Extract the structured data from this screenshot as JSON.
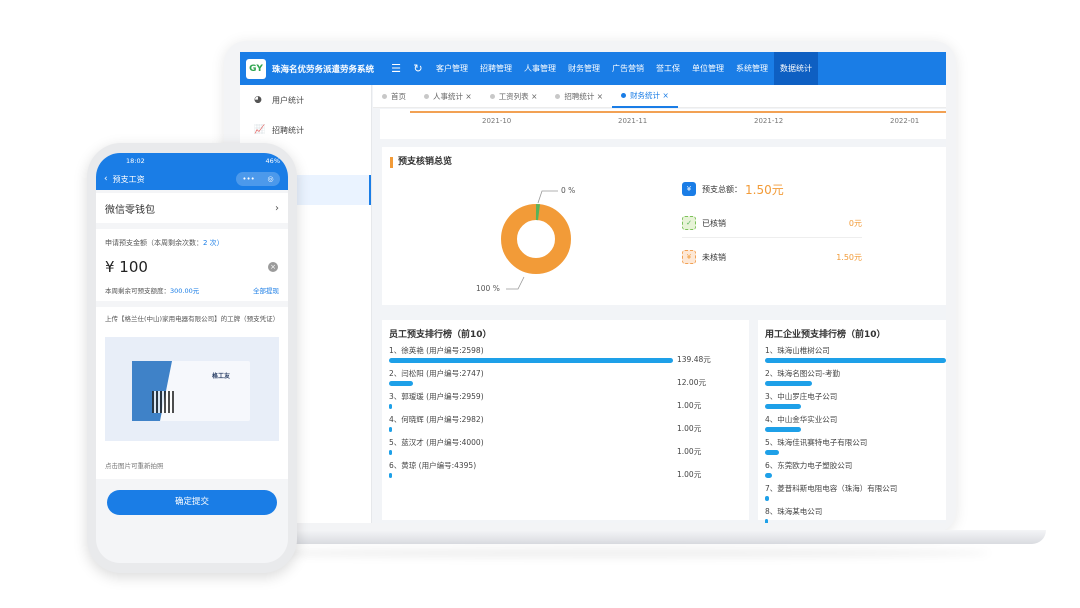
{
  "desktop": {
    "system_title": "珠海名优劳务派遣劳务系统",
    "nav_items": [
      "客户管理",
      "招聘管理",
      "人事管理",
      "财务管理",
      "广告营销",
      "誉工保",
      "单位管理",
      "系统管理",
      "数据统计"
    ],
    "active_nav": "数据统计",
    "sidebar_items": [
      {
        "label": "用户统计",
        "icon": "pie-chart-icon"
      },
      {
        "label": "招聘统计",
        "icon": "line-chart-icon"
      },
      {
        "label": "",
        "icon": "plus-icon"
      },
      {
        "label": "",
        "icon": ""
      }
    ],
    "tabs": [
      {
        "label": "首页",
        "close": ""
      },
      {
        "label": "人事统计",
        "close": "×"
      },
      {
        "label": "工资列表",
        "close": "×"
      },
      {
        "label": "招聘统计",
        "close": "×"
      },
      {
        "label": "财务统计",
        "close": "×"
      }
    ],
    "timeline_ticks": [
      "2021-10",
      "2021-11",
      "2021-12",
      "2022-01"
    ],
    "overview": {
      "title": "预支核销总览",
      "total_label": "预支总额：",
      "total_value": "1.50元",
      "verified_label": "已核销",
      "verified_value": "0元",
      "unverified_label": "未核销",
      "unverified_value": "1.50元",
      "pie_label_top": "0 %",
      "pie_label_bottom": "100 %"
    },
    "employee_rank": {
      "title": "员工预支排行榜（前10）",
      "rows": [
        {
          "name": "1、徐英艳 (用户编号:2598)",
          "value": "139.48元",
          "amount": 139.48
        },
        {
          "name": "2、闫松阳 (用户编号:2747)",
          "value": "12.00元",
          "amount": 12.0
        },
        {
          "name": "3、郭瑷瑗 (用户编号:2959)",
          "value": "1.00元",
          "amount": 1.0
        },
        {
          "name": "4、何晓辉 (用户编号:2982)",
          "value": "1.00元",
          "amount": 1.0
        },
        {
          "name": "5、蓝汉才 (用户编号:4000)",
          "value": "1.00元",
          "amount": 1.0
        },
        {
          "name": "6、黄琼 (用户编号:4395)",
          "value": "1.00元",
          "amount": 1.0
        }
      ]
    },
    "company_rank": {
      "title": "用工企业预支排行榜（前10）",
      "rows": [
        {
          "name": "1、珠海山椎树公司",
          "share": 1.0
        },
        {
          "name": "2、珠海名图公司-考勤",
          "share": 0.26
        },
        {
          "name": "3、中山罗庄电子公司",
          "share": 0.2
        },
        {
          "name": "4、中山金华实业公司",
          "share": 0.2
        },
        {
          "name": "5、珠海佳讯赛特电子有限公司",
          "share": 0.08
        },
        {
          "name": "6、东莞欧力电子塑胶公司",
          "share": 0.04
        },
        {
          "name": "7、菱普科斯电阻电容（珠海）有限公司",
          "share": 0.02
        },
        {
          "name": "8、珠海某电公司",
          "share": 0.0
        }
      ]
    }
  },
  "phone": {
    "status_time": "18:02",
    "status_right": "46%",
    "header_title": "预支工资",
    "wallet_label": "微信零钱包",
    "apply_label": "申请预支金额（本周剩余次数：",
    "apply_count": "2 次）",
    "amount": "¥ 100",
    "limit_label": "本周剩余可预支额度：",
    "limit_value": "300.00元",
    "withdraw_all": "全部提现",
    "upload_text": "上传【格兰仕(中山)家用电器有限公司】的工牌（预支凭证）",
    "card_text": "格工友",
    "tip": "点击图片可重新拍照",
    "submit": "确定提交"
  },
  "colors": {
    "primary": "#1a7de6",
    "orange": "#f29b38",
    "green": "#58b35a",
    "bar": "#1ea0e8"
  }
}
